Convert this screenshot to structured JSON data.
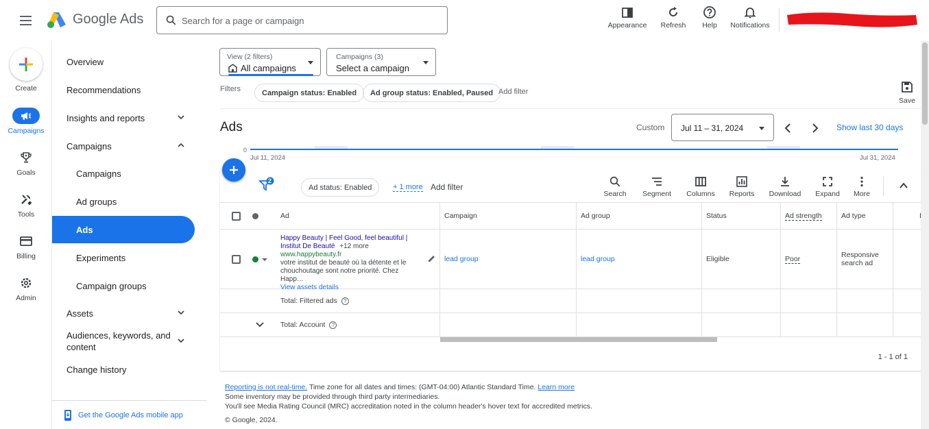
{
  "header": {
    "brand": "Google Ads",
    "search_placeholder": "Search for a page or campaign",
    "actions": [
      {
        "label": "Appearance",
        "icon": "appearance-icon"
      },
      {
        "label": "Refresh",
        "icon": "refresh-icon"
      },
      {
        "label": "Help",
        "icon": "help-icon"
      },
      {
        "label": "Notifications",
        "icon": "bell-icon"
      }
    ]
  },
  "rail": {
    "create": "Create",
    "items": [
      {
        "label": "Campaigns",
        "icon": "megaphone-icon",
        "active": true
      },
      {
        "label": "Goals",
        "icon": "trophy-icon"
      },
      {
        "label": "Tools",
        "icon": "tools-icon"
      },
      {
        "label": "Billing",
        "icon": "card-icon"
      },
      {
        "label": "Admin",
        "icon": "gear-icon"
      }
    ]
  },
  "nav": {
    "items": [
      {
        "label": "Overview"
      },
      {
        "label": "Recommendations"
      },
      {
        "label": "Insights and reports",
        "expandable": true
      },
      {
        "label": "Campaigns",
        "expanded": true
      },
      {
        "label": "Campaigns",
        "sub": true
      },
      {
        "label": "Ad groups",
        "sub": true
      },
      {
        "label": "Ads",
        "sub": true,
        "active": true
      },
      {
        "label": "Experiments",
        "sub": true
      },
      {
        "label": "Campaign groups",
        "sub": true
      },
      {
        "label": "Assets",
        "expandable": true
      },
      {
        "label": "Audiences, keywords, and content",
        "expandable": true
      },
      {
        "label": "Change history"
      }
    ],
    "footer": "Get the Google Ads mobile app"
  },
  "toolbar": {
    "view": {
      "small": "View (2 filters)",
      "value": "All campaigns"
    },
    "campaigns": {
      "small": "Campaigns (3)",
      "value": "Select a campaign"
    },
    "filters_label": "Filters",
    "filters": [
      "Campaign status: Enabled",
      "Ad group status: Enabled, Paused"
    ],
    "add_filter": "Add filter",
    "save": "Save"
  },
  "page": {
    "title": "Ads",
    "custom_label": "Custom",
    "date_range": "Jul 11 – 31, 2024",
    "show_last": "Show last 30 days"
  },
  "chart": {
    "zero_label": "0",
    "start_date": "Jul 11, 2024",
    "end_date": "Jul 31, 2024"
  },
  "table_toolbar": {
    "filter_count": "2",
    "status_chip": "Ad status: Enabled",
    "more_link": "+ 1 more",
    "add_filter": "Add filter",
    "tools": [
      {
        "label": "Search",
        "icon": "search-icon"
      },
      {
        "label": "Segment",
        "icon": "segment-icon"
      },
      {
        "label": "Columns",
        "icon": "columns-icon"
      },
      {
        "label": "Reports",
        "icon": "reports-icon"
      },
      {
        "label": "Download",
        "icon": "download-icon"
      },
      {
        "label": "Expand",
        "icon": "expand-icon"
      },
      {
        "label": "More",
        "icon": "more-vert-icon"
      }
    ]
  },
  "table": {
    "headers": {
      "ad": "Ad",
      "campaign": "Campaign",
      "ad_group": "Ad group",
      "status": "Status",
      "ad_strength": "Ad strength",
      "ad_type": "Ad type",
      "cut": "Ir"
    },
    "row": {
      "headline": "Happy Beauty | Feel Good, feel beautiful | Institut De Beauté",
      "more": "+12 more",
      "url": "www.happybeauty.fr",
      "description": "votre institut de beauté où la détente et le chouchoutage sont notre priorité. Chez Happ…",
      "view_assets": "View assets details",
      "campaign": "lead group",
      "ad_group": "lead group",
      "status": "Eligible",
      "ad_strength": "Poor",
      "ad_type": "Responsive search ad"
    },
    "total_filtered": "Total: Filtered ads",
    "total_account": "Total: Account",
    "pagination": "1 - 1 of 1"
  },
  "footer": {
    "realtime_link": "Reporting is not real-time.",
    "timezone": " Time zone for all dates and times: (GMT-04:00) Atlantic Standard Time. ",
    "learn_more": "Learn more",
    "line2": "Some inventory may be provided through third party intermediaries.",
    "line3": "You'll see Media Rating Council (MRC) accreditation noted in the column header's hover text for accredited metrics.",
    "copyright": "© Google, 2024."
  },
  "colors": {
    "accent": "#1a73e8",
    "status_green": "#188038",
    "redaction": "#e8141c"
  }
}
